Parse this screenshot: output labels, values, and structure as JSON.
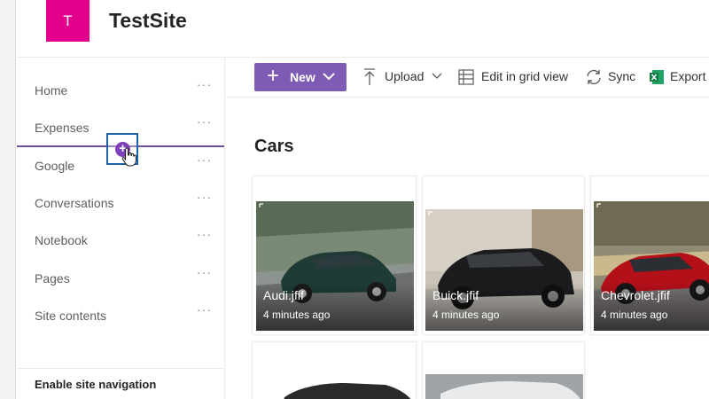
{
  "site": {
    "logo_letter": "T",
    "title": "TestSite",
    "brand_color": "#e3008c"
  },
  "nav": {
    "items": [
      {
        "label": "Home"
      },
      {
        "label": "Expenses"
      },
      {
        "label": "Google"
      },
      {
        "label": "Conversations"
      },
      {
        "label": "Notebook"
      },
      {
        "label": "Pages"
      },
      {
        "label": "Site contents"
      }
    ],
    "more_glyph": "···",
    "add_glyph": "+",
    "enable_nav_label": "Enable site navigation",
    "accent_color": "#7e3fb8"
  },
  "toolbar": {
    "new_label": "New",
    "upload_label": "Upload",
    "grid_label": "Edit in grid view",
    "sync_label": "Sync",
    "export_label": "Export",
    "new_color": "#7e5bb4"
  },
  "library": {
    "title": "Cars",
    "files": [
      {
        "name": "Audi.jfif",
        "modified": "4 minutes ago"
      },
      {
        "name": "Buick.jfif",
        "modified": "4 minutes ago"
      },
      {
        "name": "Chevrolet.jfif",
        "modified": "4 minutes ago"
      }
    ]
  },
  "icons": {
    "new": "plus-icon",
    "new_menu": "chevron-down-icon",
    "upload": "upload-arrow-icon",
    "grid": "grid-icon",
    "sync": "sync-icon",
    "export": "excel-icon",
    "drag_add": "add-circle-icon",
    "cursor": "hand-pointer-icon"
  }
}
